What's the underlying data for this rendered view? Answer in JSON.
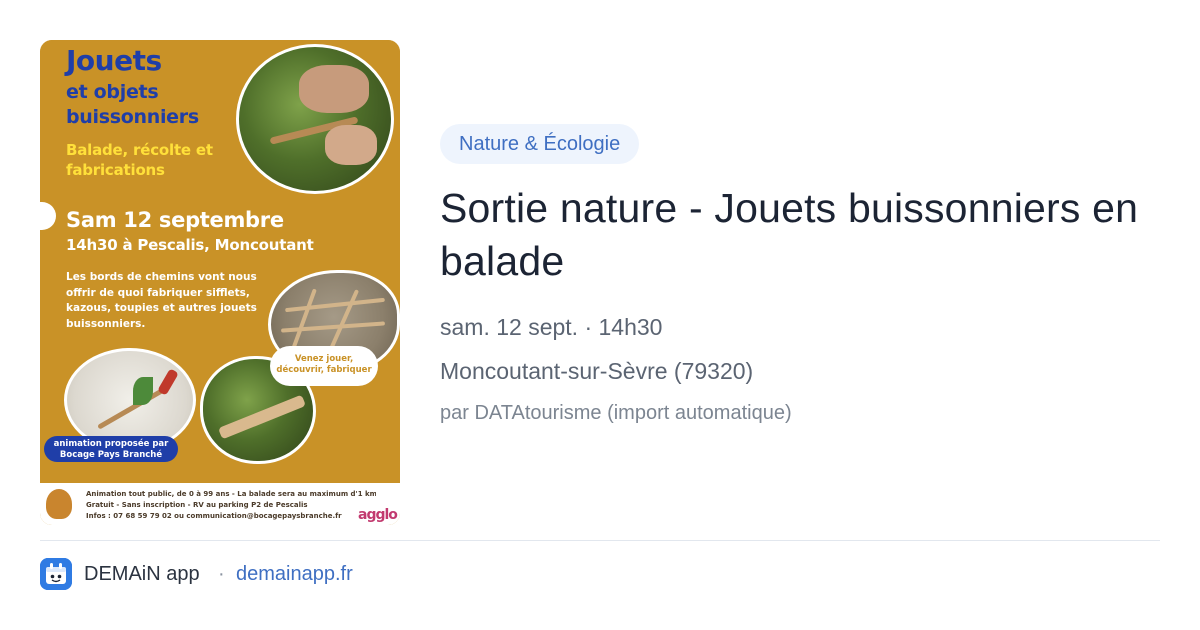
{
  "poster": {
    "title": "Jouets",
    "subtitle": "et objets buissonniers",
    "tagline": "Balade, récolte et fabrications",
    "date": "Sam 12 septembre",
    "time_place": "14h30 à Pescalis, Moncoutant",
    "description": "Les bords de chemins vont nous offrir de quoi fabriquer sifflets, kazous, toupies et autres jouets buissonniers.",
    "callout": "Venez jouer, découvrir, fabriquer",
    "organizer_badge": "animation proposée par Bocage Pays Branché",
    "footer_line1": "Animation tout public, de 0 à 99 ans - La balade sera au maximum d'1 km -",
    "footer_line2": "Gratuit - Sans inscription - RV au parking P2 de Pescalis",
    "footer_line3": "Infos : 07 68 59 79 02 ou communication@bocagepaysbranche.fr",
    "footer_logo": "agglo"
  },
  "event": {
    "category": "Nature & Écologie",
    "title": "Sortie nature - Jouets buissonniers en balade",
    "datetime": "sam. 12 sept. · 14h30",
    "location": "Moncoutant-sur-Sèvre (79320)",
    "source": "par DATAtourisme (import automatique)"
  },
  "footer": {
    "app_icon": "demain-app-icon",
    "app_name": "DEMAiN app",
    "separator": "·",
    "domain": "demainapp.fr"
  },
  "colors": {
    "poster_background": "#c99227",
    "poster_title": "#1f3ea8",
    "poster_tagline": "#ffe03a",
    "category_pill_bg": "#eef4fd",
    "category_pill_text": "#3f6fc2",
    "link": "#3f6fc2",
    "app_icon_bg": "#2f7be3"
  }
}
